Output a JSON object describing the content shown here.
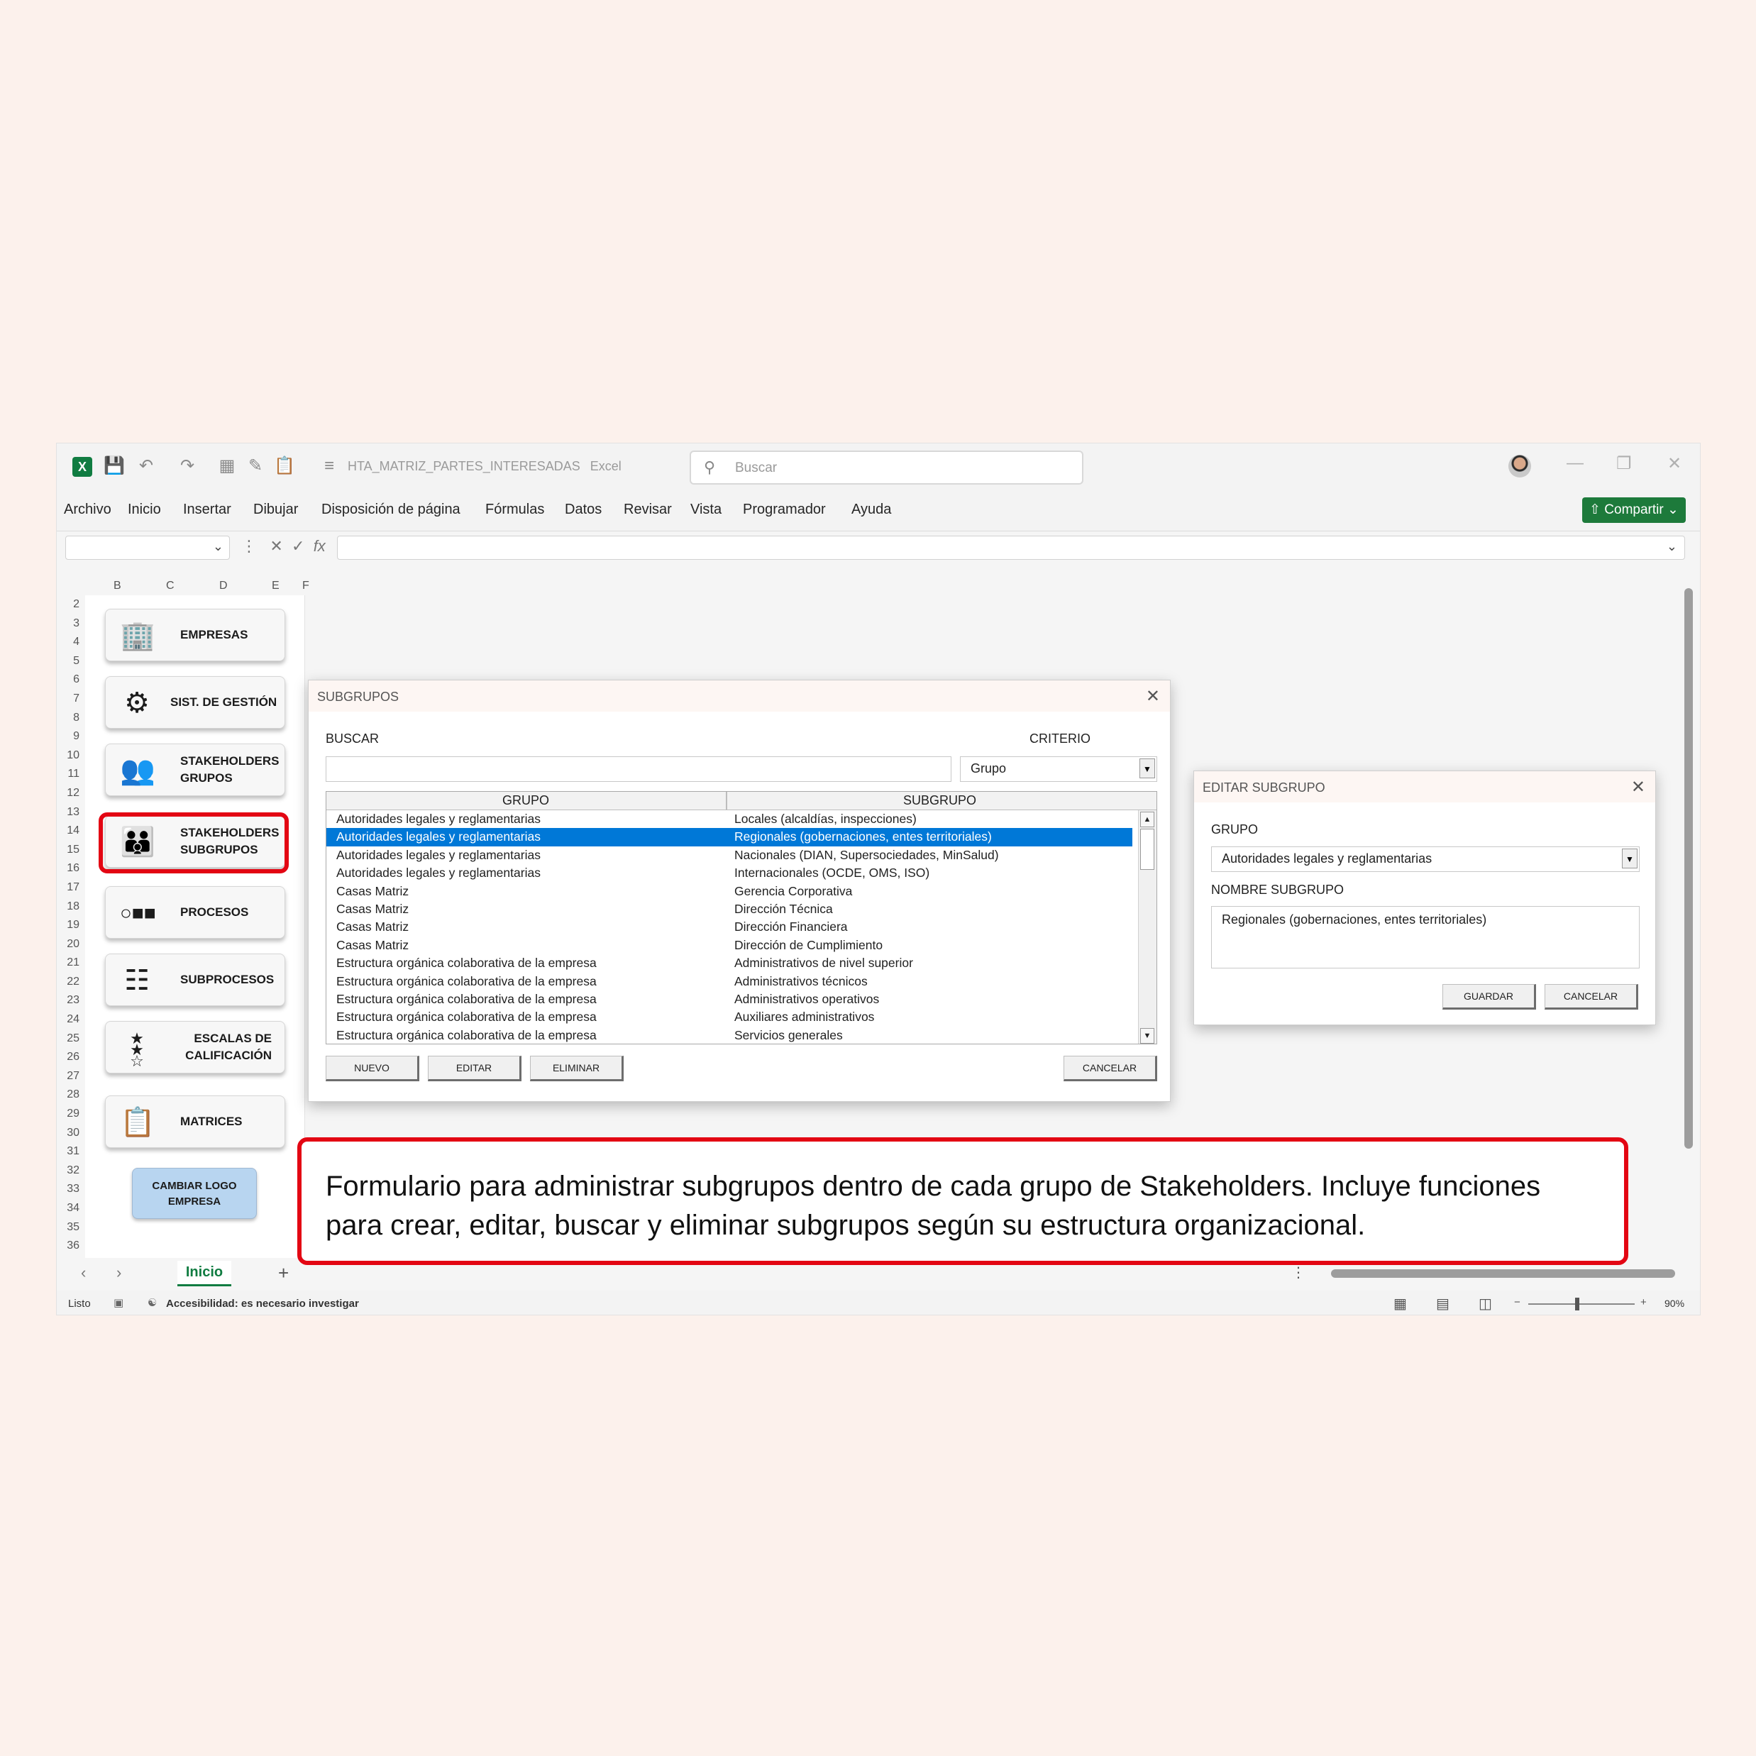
{
  "window": {
    "doc_title": "HTA_MATRIZ_PARTES_INTERESADAS",
    "app_name": "Excel",
    "search_placeholder": "Buscar",
    "share_label": "Compartir"
  },
  "menu": [
    "Archivo",
    "Inicio",
    "Insertar",
    "Dibujar",
    "Disposición de página",
    "Fórmulas",
    "Datos",
    "Revisar",
    "Vista",
    "Programador",
    "Ayuda"
  ],
  "columns": [
    "B",
    "C",
    "D",
    "E",
    "F"
  ],
  "rows": [
    "2",
    "3",
    "4",
    "5",
    "6",
    "7",
    "8",
    "9",
    "10",
    "11",
    "12",
    "13",
    "14",
    "15",
    "16",
    "17",
    "18",
    "19",
    "20",
    "21",
    "22",
    "23",
    "24",
    "25",
    "26",
    "27",
    "28",
    "29",
    "30",
    "31",
    "32",
    "33",
    "34",
    "35",
    "36"
  ],
  "nav": {
    "empresas": "EMPRESAS",
    "sist_gestion": "SIST. DE GESTIÓN",
    "stakeholders_grupos_1": "STAKEHOLDERS",
    "stakeholders_grupos_2": "GRUPOS",
    "stakeholders_subgrupos_1": "STAKEHOLDERS",
    "stakeholders_subgrupos_2": "SUBGRUPOS",
    "procesos": "PROCESOS",
    "subprocesos": "SUBPROCESOS",
    "escalas_1": "ESCALAS DE",
    "escalas_2": "CALIFICACIÓN",
    "matrices": "MATRICES",
    "logo_1": "CAMBIAR LOGO",
    "logo_2": "EMPRESA"
  },
  "subgrupos_dialog": {
    "title": "SUBGRUPOS",
    "buscar_label": "BUSCAR",
    "criterio_label": "CRITERIO",
    "criterio_value": "Grupo",
    "col_grupo": "GRUPO",
    "col_subgrupo": "SUBGRUPO",
    "rows": [
      {
        "grupo": "Autoridades legales y reglamentarias",
        "subgrupo": "Locales (alcaldías, inspecciones)"
      },
      {
        "grupo": "Autoridades legales y reglamentarias",
        "subgrupo": "Regionales (gobernaciones, entes territoriales)"
      },
      {
        "grupo": "Autoridades legales y reglamentarias",
        "subgrupo": "Nacionales (DIAN, Supersociedades, MinSalud)"
      },
      {
        "grupo": "Autoridades legales y reglamentarias",
        "subgrupo": "Internacionales (OCDE, OMS, ISO)"
      },
      {
        "grupo": "Casas Matriz",
        "subgrupo": "Gerencia Corporativa"
      },
      {
        "grupo": "Casas Matriz",
        "subgrupo": "Dirección Técnica"
      },
      {
        "grupo": "Casas Matriz",
        "subgrupo": "Dirección Financiera"
      },
      {
        "grupo": "Casas Matriz",
        "subgrupo": "Dirección de Cumplimiento"
      },
      {
        "grupo": "Estructura orgánica colaborativa de la empresa",
        "subgrupo": "Administrativos de nivel superior"
      },
      {
        "grupo": "Estructura orgánica colaborativa de la empresa",
        "subgrupo": "Administrativos técnicos"
      },
      {
        "grupo": "Estructura orgánica colaborativa de la empresa",
        "subgrupo": "Administrativos operativos"
      },
      {
        "grupo": "Estructura orgánica colaborativa de la empresa",
        "subgrupo": "Auxiliares administrativos"
      },
      {
        "grupo": "Estructura orgánica colaborativa de la empresa",
        "subgrupo": "Servicios generales"
      }
    ],
    "btn_nuevo": "NUEVO",
    "btn_editar": "EDITAR",
    "btn_eliminar": "ELIMINAR",
    "btn_cancelar": "CANCELAR"
  },
  "editar_dialog": {
    "title": "EDITAR SUBGRUPO",
    "grupo_label": "GRUPO",
    "grupo_value": "Autoridades legales y reglamentarias",
    "nombre_label": "NOMBRE SUBGRUPO",
    "nombre_value": "Regionales (gobernaciones, entes territoriales)",
    "btn_guardar": "GUARDAR",
    "btn_cancelar": "CANCELAR"
  },
  "sheet_tab": "Inicio",
  "status": {
    "ready": "Listo",
    "accessibility": "Accesibilidad: es necesario investigar",
    "zoom": "90%"
  },
  "caption": "Formulario para administrar subgrupos dentro de cada grupo de Stakeholders. Incluye funciones para crear, editar, buscar y eliminar subgrupos según su estructura organizacional.",
  "colors": {
    "accent_green": "#107c41",
    "selection_blue": "#0078d7",
    "highlight_red": "#e30613"
  }
}
